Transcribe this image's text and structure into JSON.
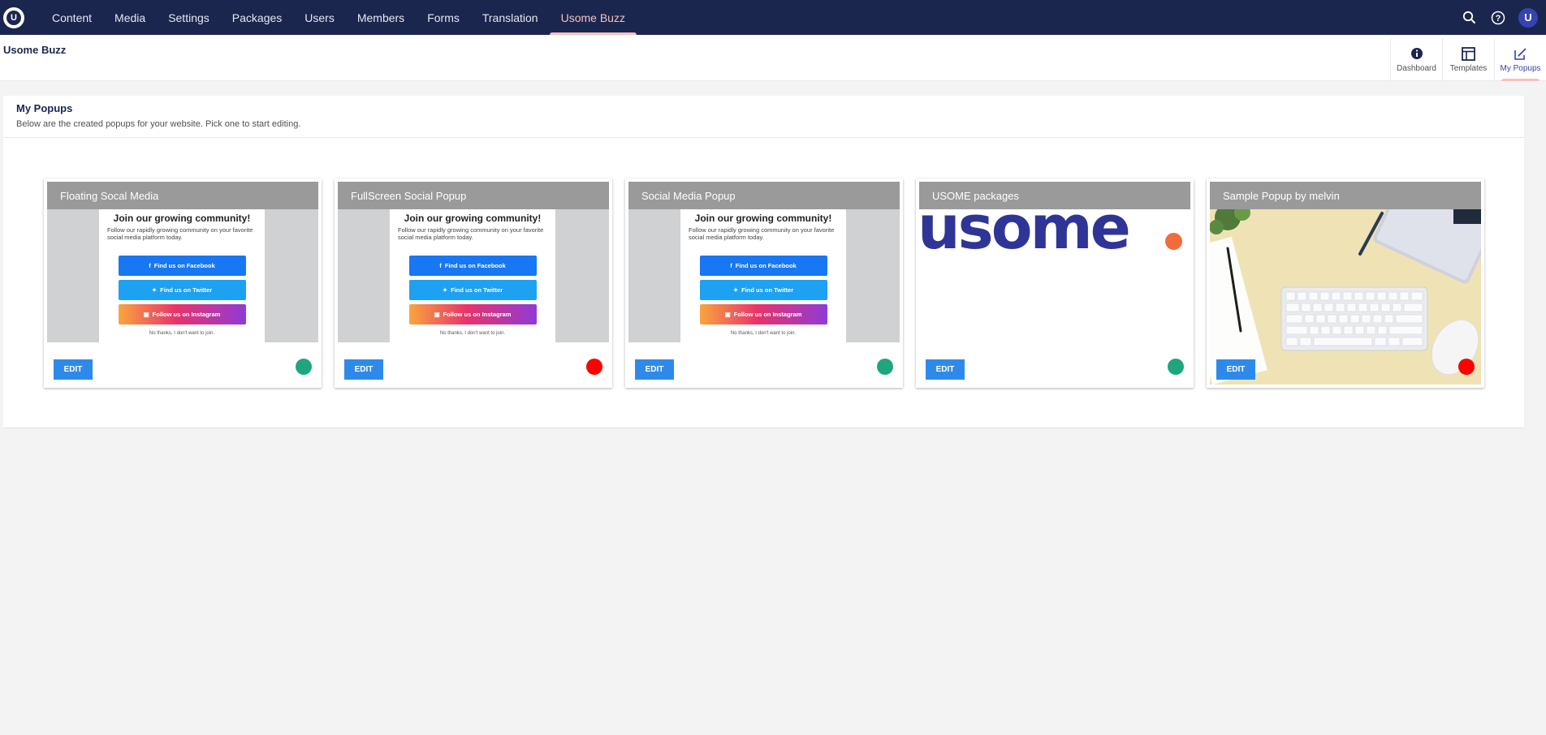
{
  "nav": {
    "items": [
      "Content",
      "Media",
      "Settings",
      "Packages",
      "Users",
      "Members",
      "Forms",
      "Translation",
      "Usome Buzz"
    ],
    "active_index": 8
  },
  "avatar_letter": "U",
  "logo_letter": "U",
  "header": {
    "title": "Usome Buzz",
    "apps": [
      {
        "label": "Dashboard",
        "icon": "info-icon"
      },
      {
        "label": "Templates",
        "icon": "templates-icon"
      },
      {
        "label": "My Popups",
        "icon": "edit-icon"
      }
    ],
    "active_app": 2
  },
  "panel": {
    "title": "My Popups",
    "description": "Below are the created popups for your website. Pick one to start editing."
  },
  "social_preview": {
    "title": "Join our growing community!",
    "description": "Follow our rapidly growing community on your favorite social media platform today.",
    "facebook": "Find us on Facebook",
    "twitter": "Find us on Twitter",
    "instagram": "Follow us on Instagram",
    "decline": "No thanks, I don't want to join."
  },
  "usome_logo_text": "usome",
  "edit_label": "EDIT",
  "colors": {
    "active": "#1fa67e",
    "inactive": "#ff0000",
    "topbar": "#1b264f",
    "edit": "#2e8aea"
  },
  "popups": [
    {
      "title": "Floating Socal Media",
      "status": "active",
      "preview": "social"
    },
    {
      "title": "FullScreen Social Popup",
      "status": "inactive",
      "preview": "social"
    },
    {
      "title": "Social Media Popup",
      "status": "active",
      "preview": "social"
    },
    {
      "title": "USOME packages",
      "status": "active",
      "preview": "usome-logo"
    },
    {
      "title": "Sample Popup by melvin",
      "status": "inactive",
      "preview": "desk-photo"
    }
  ]
}
